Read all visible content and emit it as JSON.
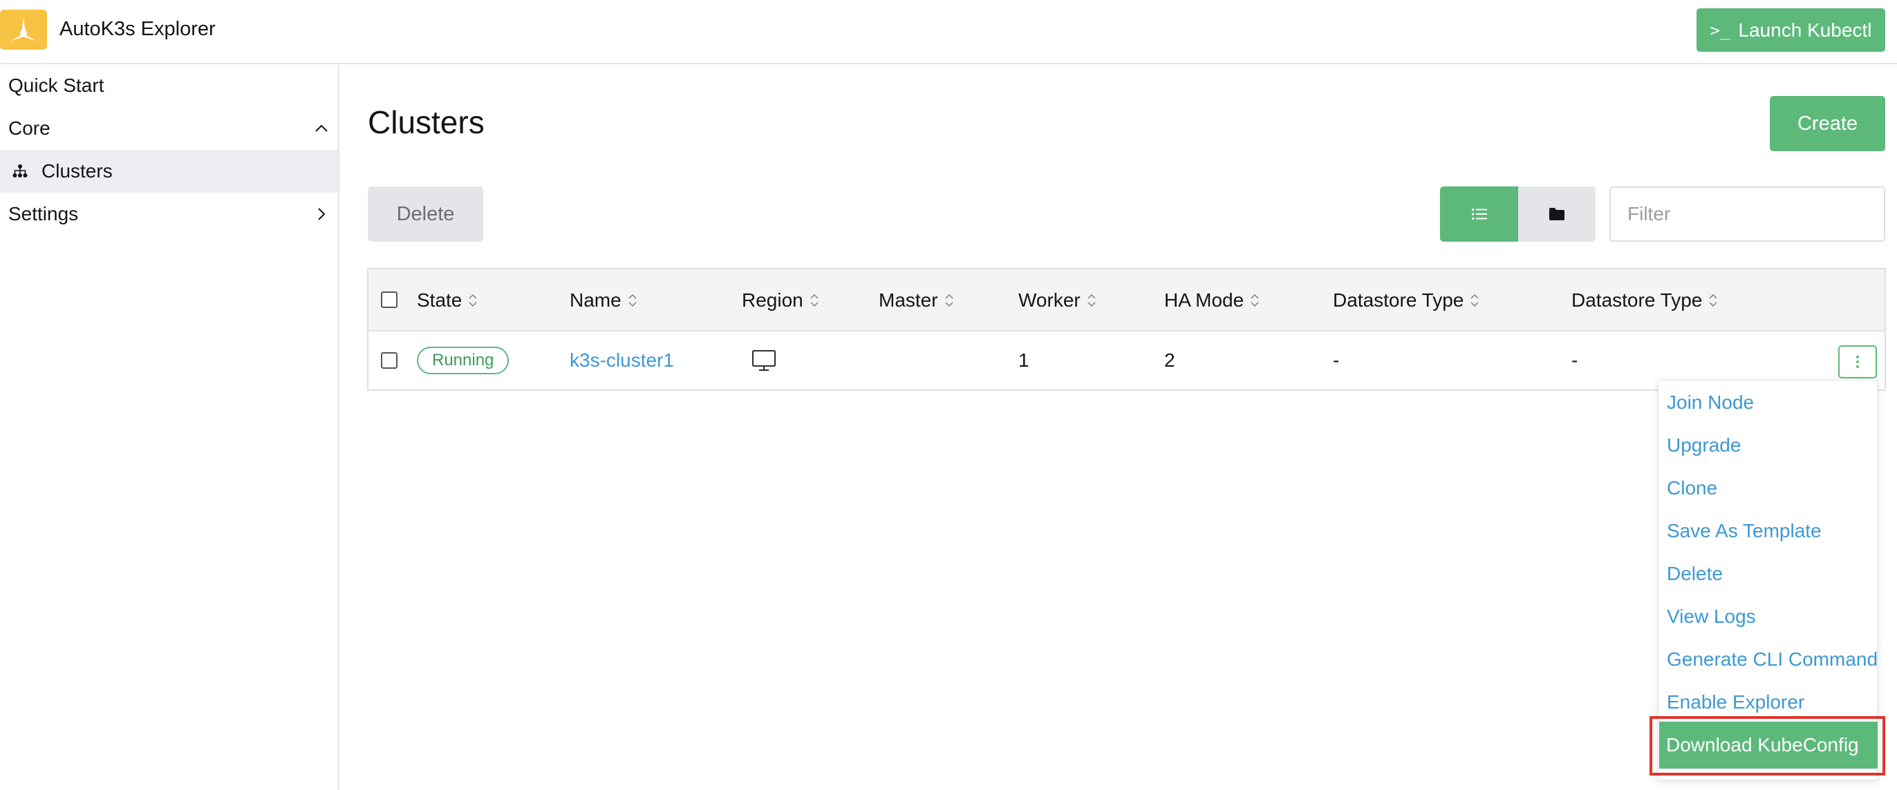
{
  "header": {
    "app_title": "AutoK3s Explorer",
    "launch_prompt": ">_",
    "launch_label": "Launch Kubectl"
  },
  "sidebar": {
    "items": [
      {
        "label": "Quick Start"
      },
      {
        "label": "Core",
        "expanded": true
      },
      {
        "label": "Clusters",
        "active": true,
        "icon": "cluster-tree-icon"
      },
      {
        "label": "Settings",
        "expanded": false
      }
    ]
  },
  "main": {
    "title": "Clusters",
    "create_label": "Create",
    "delete_label": "Delete",
    "filter_placeholder": "Filter",
    "view_toggle": {
      "selected": "list",
      "options": [
        "list-icon",
        "folder-icon"
      ]
    }
  },
  "table": {
    "columns": [
      "State",
      "Name",
      "Region",
      "Master",
      "Worker",
      "HA Mode",
      "Datastore Type",
      "Datastore Type"
    ],
    "rows": [
      {
        "state": "Running",
        "name": "k3s-cluster1",
        "region_icon": "monitor-icon",
        "master": "",
        "worker": "1",
        "ha_mode": "2",
        "datastore_type": "-",
        "datastore_type_2": "-"
      }
    ]
  },
  "row_menu": {
    "items": [
      "Join Node",
      "Upgrade",
      "Clone",
      "Save As Template",
      "Delete",
      "View Logs",
      "Generate CLI Command",
      "Enable Explorer",
      "Download KubeConfig"
    ],
    "highlighted": "Download KubeConfig"
  },
  "colors": {
    "primary": "#5cb97a",
    "link": "#3d98d3",
    "logo": "#f6c342",
    "highlight_border": "#e0352b"
  }
}
